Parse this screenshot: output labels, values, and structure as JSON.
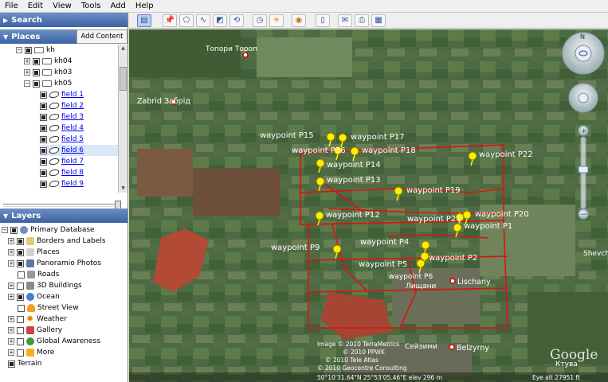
{
  "menu": [
    "File",
    "Edit",
    "View",
    "Tools",
    "Add",
    "Help"
  ],
  "search": {
    "header": "Search"
  },
  "places": {
    "header": "Places",
    "add_content_label": "Add Content",
    "items": [
      {
        "label": "kh"
      },
      {
        "label": "kh04"
      },
      {
        "label": "kh03"
      },
      {
        "label": "kh05"
      },
      {
        "label": "field 1"
      },
      {
        "label": "field 2"
      },
      {
        "label": "field 3"
      },
      {
        "label": "field 4"
      },
      {
        "label": "field 5"
      },
      {
        "label": "field 6"
      },
      {
        "label": "field 7"
      },
      {
        "label": "field 8"
      },
      {
        "label": "field 9"
      }
    ]
  },
  "layers": {
    "header": "Layers",
    "items": [
      {
        "label": "Primary Database"
      },
      {
        "label": "Borders and Labels"
      },
      {
        "label": "Places"
      },
      {
        "label": "Panoramio Photos"
      },
      {
        "label": "Roads"
      },
      {
        "label": "3D Buildings"
      },
      {
        "label": "Ocean"
      },
      {
        "label": "Street View"
      },
      {
        "label": "Weather"
      },
      {
        "label": "Gallery"
      },
      {
        "label": "Global Awareness"
      },
      {
        "label": "More"
      },
      {
        "label": "Terrain"
      }
    ]
  },
  "map": {
    "towns": {
      "toropy": "Топори  Тороп",
      "zabrid": "Zabrid  Забрід",
      "lischany": "Lischany",
      "lischany_cyr": "Лищани",
      "belzyrny": "Belzyrny",
      "seyzimi": "Сейзими",
      "shevchenk": "Shevchenk"
    },
    "waypoints": {
      "p15": "waypoint P15",
      "p17": "waypoint P17",
      "p16": "waypoint P16",
      "p18": "waypoint P18",
      "p22": "waypoint P22",
      "p14": "waypoint P14",
      "p13": "waypoint P13",
      "p19": "waypoint P19",
      "p12": "waypoint P12",
      "p21": "waypoint P21",
      "p20": "waypoint P20",
      "p1": "waypoint P1",
      "p9": "waypoint P9",
      "p4": "waypoint P4",
      "p2": "waypoint P2",
      "p5": "waypoint P5",
      "p6": "waypoint P6"
    },
    "attribution": [
      "Image © 2010 TerraMetrics",
      "© 2010 PPWK",
      "© 2010 Tele Atlas",
      "© 2010 Geocentre Consulting"
    ],
    "google_logo": "Google",
    "status_coords": "50°10'31.64\"N  25°53'05.46\"E  elev  296 m",
    "eye_alt": "Eye alt  27951 ft",
    "cyr_label": "Ктува"
  },
  "colors": {
    "field_outline": "#e01010",
    "pin": "#ffee00",
    "link": "#0000ee",
    "panel_header": "#3c62a6"
  }
}
